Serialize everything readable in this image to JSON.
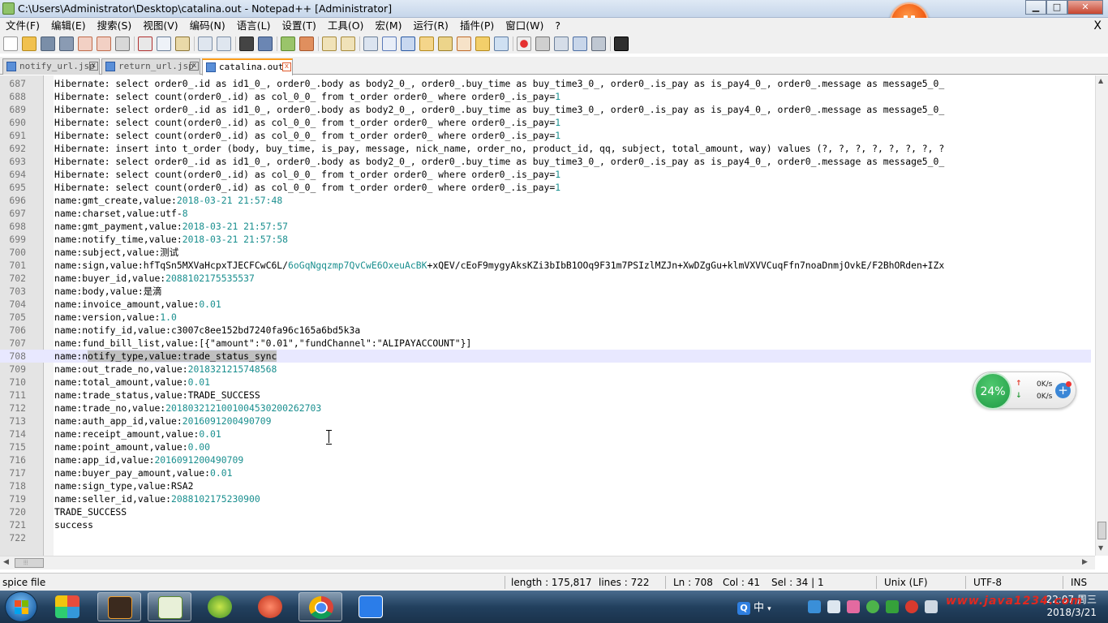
{
  "window": {
    "title": "C:\\Users\\Administrator\\Desktop\\catalina.out - Notepad++ [Administrator]",
    "min_glyph": "▁",
    "max_glyph": "□",
    "close_glyph": "✕"
  },
  "menu": {
    "items": [
      "文件(F)",
      "编辑(E)",
      "搜索(S)",
      "视图(V)",
      "编码(N)",
      "语言(L)",
      "设置(T)",
      "工具(O)",
      "宏(M)",
      "运行(R)",
      "插件(P)",
      "窗口(W)",
      "?"
    ],
    "close_glyph": "X"
  },
  "tabs": [
    {
      "label": "notify_url.jsp",
      "active": false
    },
    {
      "label": "return_url.jsp",
      "active": false
    },
    {
      "label": "catalina.out",
      "active": true
    }
  ],
  "tab_close_glyph": "x",
  "editor": {
    "lines": [
      {
        "n": "687",
        "text": "Hibernate: select order0_.id as id1_0_, order0_.body as body2_0_, order0_.buy_time as buy_time3_0_, order0_.is_pay as is_pay4_0_, order0_.message as message5_0_"
      },
      {
        "n": "688",
        "text": "Hibernate: select count(order0_.id) as col_0_0_ from t_order order0_ where order0_.is_pay=",
        "num": "1"
      },
      {
        "n": "689",
        "text": "Hibernate: select order0_.id as id1_0_, order0_.body as body2_0_, order0_.buy_time as buy_time3_0_, order0_.is_pay as is_pay4_0_, order0_.message as message5_0_"
      },
      {
        "n": "690",
        "text": "Hibernate: select count(order0_.id) as col_0_0_ from t_order order0_ where order0_.is_pay=",
        "num": "1"
      },
      {
        "n": "691",
        "text": "Hibernate: select count(order0_.id) as col_0_0_ from t_order order0_ where order0_.is_pay=",
        "num": "1"
      },
      {
        "n": "692",
        "text": "Hibernate: insert into t_order (body, buy_time, is_pay, message, nick_name, order_no, product_id, qq, subject, total_amount, way) values (?, ?, ?, ?, ?, ?, ?, ?"
      },
      {
        "n": "693",
        "text": "Hibernate: select order0_.id as id1_0_, order0_.body as body2_0_, order0_.buy_time as buy_time3_0_, order0_.is_pay as is_pay4_0_, order0_.message as message5_0_"
      },
      {
        "n": "694",
        "text": "Hibernate: select count(order0_.id) as col_0_0_ from t_order order0_ where order0_.is_pay=",
        "num": "1"
      },
      {
        "n": "695",
        "text": "Hibernate: select count(order0_.id) as col_0_0_ from t_order order0_ where order0_.is_pay=",
        "num": "1"
      },
      {
        "n": "696",
        "text": "name:gmt_create,value:",
        "num": "2018-03-21 21:57:48"
      },
      {
        "n": "697",
        "text": "name:charset,value:utf-",
        "num": "8"
      },
      {
        "n": "698",
        "text": "name:gmt_payment,value:",
        "num": "2018-03-21 21:57:57"
      },
      {
        "n": "699",
        "text": "name:notify_time,value:",
        "num": "2018-03-21 21:57:58"
      },
      {
        "n": "700",
        "text": "name:subject,value:测试"
      },
      {
        "n": "701",
        "text": "name:sign,value:hfTqSn5MXVaHcpxTJECFCwC6L/",
        "num": "6oGqNgqzmp7QvCwE6OxeuAcBK",
        "tail": "+xQEV/cEoF9mygyAksKZi3bIbB1OOq9F31m7PSIzlMZJn+XwDZgGu+klmVXVVCuqFfn7noaDnmjOvkE/F2BhORden+IZx"
      },
      {
        "n": "702",
        "text": "name:buyer_id,value:",
        "num": "2088102175535537"
      },
      {
        "n": "703",
        "text": "name:body,value:是滴"
      },
      {
        "n": "704",
        "text": "name:invoice_amount,value:",
        "num": "0.01"
      },
      {
        "n": "705",
        "text": "name:version,value:",
        "num": "1.0"
      },
      {
        "n": "706",
        "text": "name:notify_id,value:c3007c8ee152bd7240fa96c165a6bd5k3a"
      },
      {
        "n": "707",
        "text": "name:fund_bill_list,value:[{\"amount\":\"0.01\",\"fundChannel\":\"ALIPAYACCOUNT\"}]"
      },
      {
        "n": "708",
        "text": "name:n",
        "sel": "otify_type,value:trade_status_sync",
        "cur": true
      },
      {
        "n": "709",
        "text": "name:out_trade_no,value:",
        "num": "2018321215748568"
      },
      {
        "n": "710",
        "text": "name:total_amount,value:",
        "num": "0.01"
      },
      {
        "n": "711",
        "text": "name:trade_status,value:TRADE_SUCCESS"
      },
      {
        "n": "712",
        "text": "name:trade_no,value:",
        "num": "2018032121001004530200262703"
      },
      {
        "n": "713",
        "text": "name:auth_app_id,value:",
        "num": "2016091200490709"
      },
      {
        "n": "714",
        "text": "name:receipt_amount,value:",
        "num": "0.01"
      },
      {
        "n": "715",
        "text": "name:point_amount,value:",
        "num": "0.00"
      },
      {
        "n": "716",
        "text": "name:app_id,value:",
        "num": "2016091200490709"
      },
      {
        "n": "717",
        "text": "name:buyer_pay_amount,value:",
        "num": "0.01"
      },
      {
        "n": "718",
        "text": "name:sign_type,value:RSA2"
      },
      {
        "n": "719",
        "text": "name:seller_id,value:",
        "num": "2088102175230900"
      },
      {
        "n": "720",
        "text": "TRADE_SUCCESS"
      },
      {
        "n": "721",
        "text": "success"
      },
      {
        "n": "722",
        "text": ""
      }
    ]
  },
  "scroll": {
    "up_glyph": "▲",
    "down_glyph": "▼",
    "left_glyph": "◀",
    "right_glyph": "▶",
    "grip": "⦙⦙⦙"
  },
  "status": {
    "file_type": "spice file",
    "length": "length : 175,817",
    "lines": "lines : 722",
    "ln": "Ln : 708",
    "col": "Col : 41",
    "sel": "Sel : 34 | 1",
    "eol": "Unix (LF)",
    "encoding": "UTF-8",
    "mode": "INS"
  },
  "speed_widget": {
    "percent": "24%",
    "up_arrow": "↑",
    "down_arrow": "↓",
    "up": "0K/s",
    "down": "0K/s",
    "plus": "+"
  },
  "taskbar": {
    "ime_q": "Q",
    "ime": "中",
    "ime_caret": "▾",
    "watermark": "www.java1234.com",
    "time": "22:07 周三",
    "date": "2018/3/21"
  },
  "colors": {
    "numeric_text": "#1a8f8f",
    "current_line": "#e8e8ff",
    "selection": "#c0c0c0",
    "active_tab_accent": "#fa9c1a"
  }
}
